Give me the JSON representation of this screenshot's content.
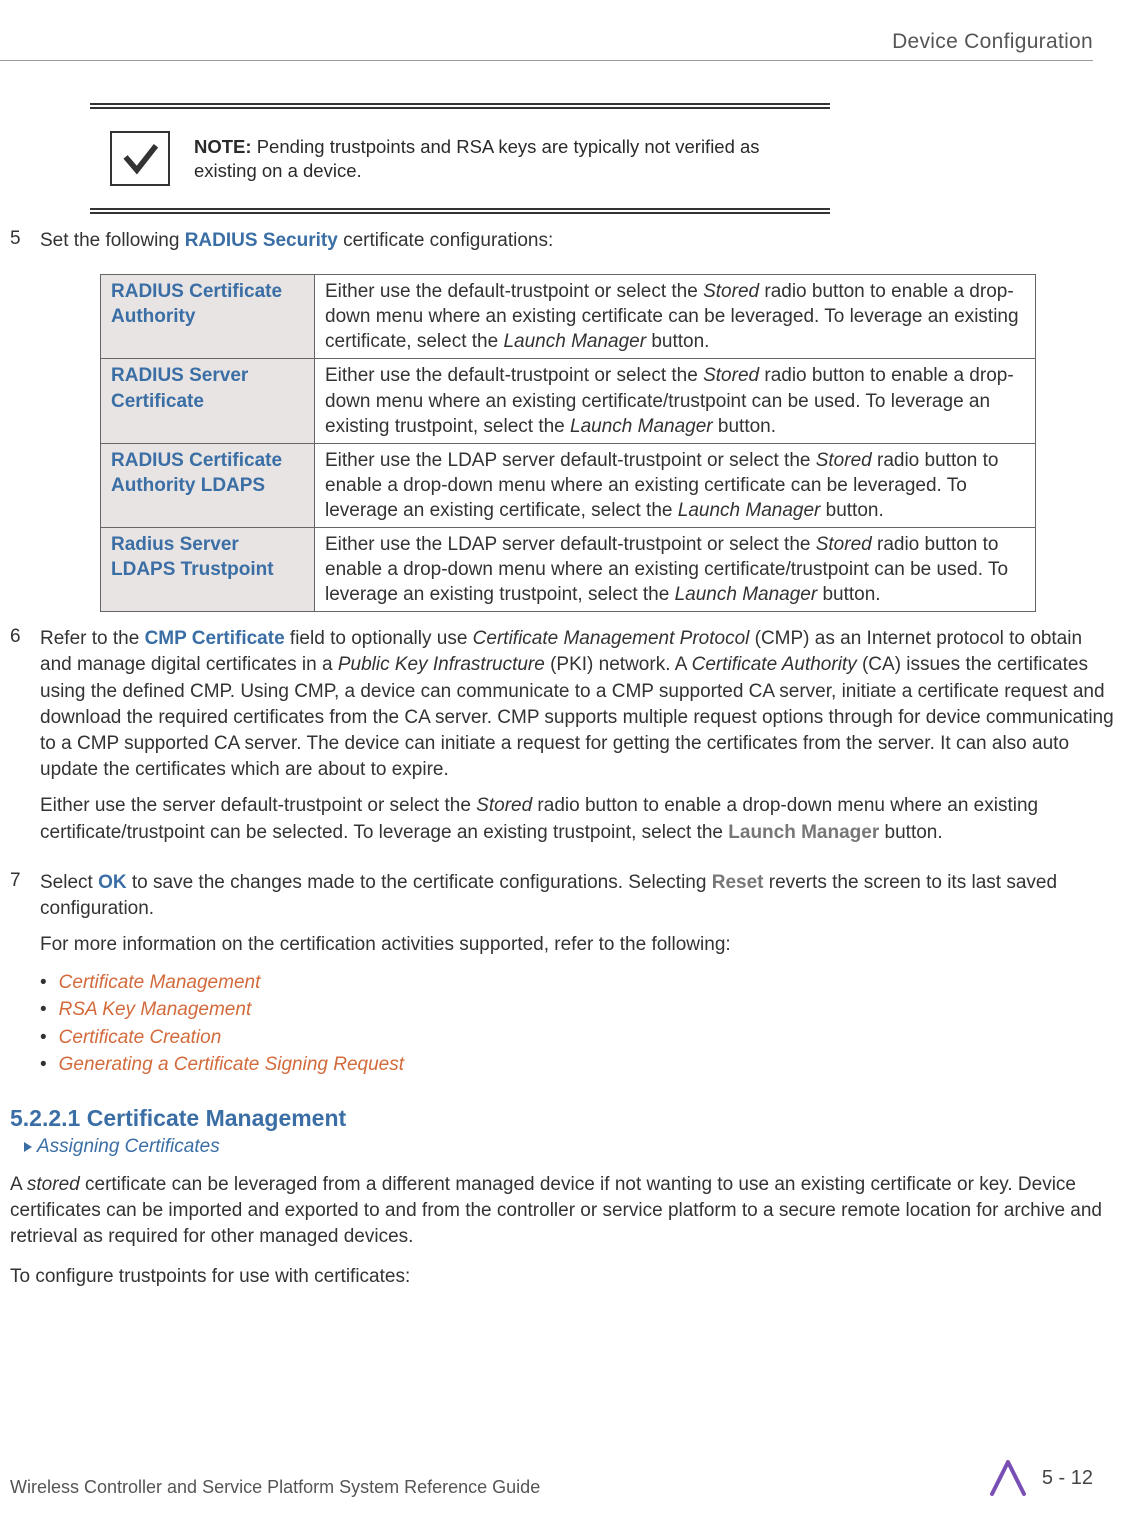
{
  "header": {
    "section_title": "Device Configuration"
  },
  "note": {
    "label": "NOTE:",
    "text": "Pending trustpoints and RSA keys are typically not verified as existing on a device."
  },
  "step5": {
    "num": "5",
    "intro_prefix": "Set the following ",
    "intro_bold": "RADIUS Security",
    "intro_suffix": " certificate configurations:"
  },
  "table": {
    "rows": [
      {
        "label": "RADIUS Certificate Authority",
        "desc_1": "Either use the default-trustpoint or select the ",
        "desc_em1": "Stored",
        "desc_2": " radio button to enable a drop-down menu where an existing certificate can be leveraged. To leverage an existing certificate, select the ",
        "desc_em2": "Launch Manager",
        "desc_3": " button."
      },
      {
        "label": "RADIUS Server Certificate",
        "desc_1": "Either use the default-trustpoint or select the ",
        "desc_em1": "Stored",
        "desc_2": " radio button to enable a drop-down menu where an existing certificate/trustpoint can be used. To leverage an existing trustpoint, select the ",
        "desc_em2": "Launch Manager",
        "desc_3": " button."
      },
      {
        "label": "RADIUS Certificate Authority LDAPS",
        "desc_1": "Either use the LDAP server default-trustpoint or select the ",
        "desc_em1": "Stored",
        "desc_2": " radio button to enable a drop-down menu where an existing certificate can be leveraged. To leverage an existing certificate, select the ",
        "desc_em2": "Launch Manager",
        "desc_3": " button."
      },
      {
        "label": "Radius Server LDAPS Trustpoint",
        "desc_1": "Either use the LDAP server default-trustpoint or select the ",
        "desc_em1": "Stored",
        "desc_2": " radio button to enable a drop-down menu where an existing certificate/trustpoint can be used. To leverage an existing trustpoint, select the ",
        "desc_em2": "Launch Manager",
        "desc_3": " button."
      }
    ]
  },
  "step6": {
    "num": "6",
    "p1_a": "Refer to the ",
    "p1_b": "CMP Certificate",
    "p1_c": " field to optionally use ",
    "p1_em1": "Certificate Management Protocol",
    "p1_d": " (CMP) as an Internet protocol to obtain and manage digital certificates in a ",
    "p1_em2": "Public Key Infrastructure",
    "p1_e": " (PKI) network. A ",
    "p1_em3": "Certificate Authority",
    "p1_f": " (CA) issues the certificates using the defined CMP. Using CMP, a device can communicate to a CMP supported CA server, initiate a certificate request and download the required certificates from the CA server. CMP supports multiple request options through for device communicating to a CMP supported CA server. The device can initiate a request for getting the certificates from the server. It can also auto update the certificates which are about to expire.",
    "p2_a": "Either use the server default-trustpoint or select the ",
    "p2_em": "Stored",
    "p2_b": " radio button to enable a drop-down menu where an existing certificate/trustpoint can be selected. To leverage an existing trustpoint, select the ",
    "p2_bold": "Launch Manager",
    "p2_c": " button."
  },
  "step7": {
    "num": "7",
    "p1_a": "Select ",
    "p1_b": "OK",
    "p1_c": " to save the changes made to the certificate configurations. Selecting ",
    "p1_d": "Reset",
    "p1_e": " reverts the screen to its last saved configuration.",
    "p2": "For more information on the certification activities supported, refer to the following:",
    "links": [
      "Certificate Management",
      "RSA Key Management",
      "Certificate Creation",
      "Generating a Certificate Signing Request"
    ]
  },
  "sub": {
    "heading": "5.2.2.1 Certificate Management",
    "breadcrumb": "Assigning Certificates"
  },
  "para1_a": "A ",
  "para1_em": "stored",
  "para1_b": " certificate can be leveraged from a different managed device if not wanting to use an existing certificate or key. Device certificates can be imported and exported to and from the controller or service platform to a secure remote location for archive and retrieval as required for other managed devices.",
  "para2": "To configure trustpoints for use with certificates:",
  "footer": {
    "left": "Wireless Controller and Service Platform System Reference Guide",
    "page": "5 - 12"
  }
}
